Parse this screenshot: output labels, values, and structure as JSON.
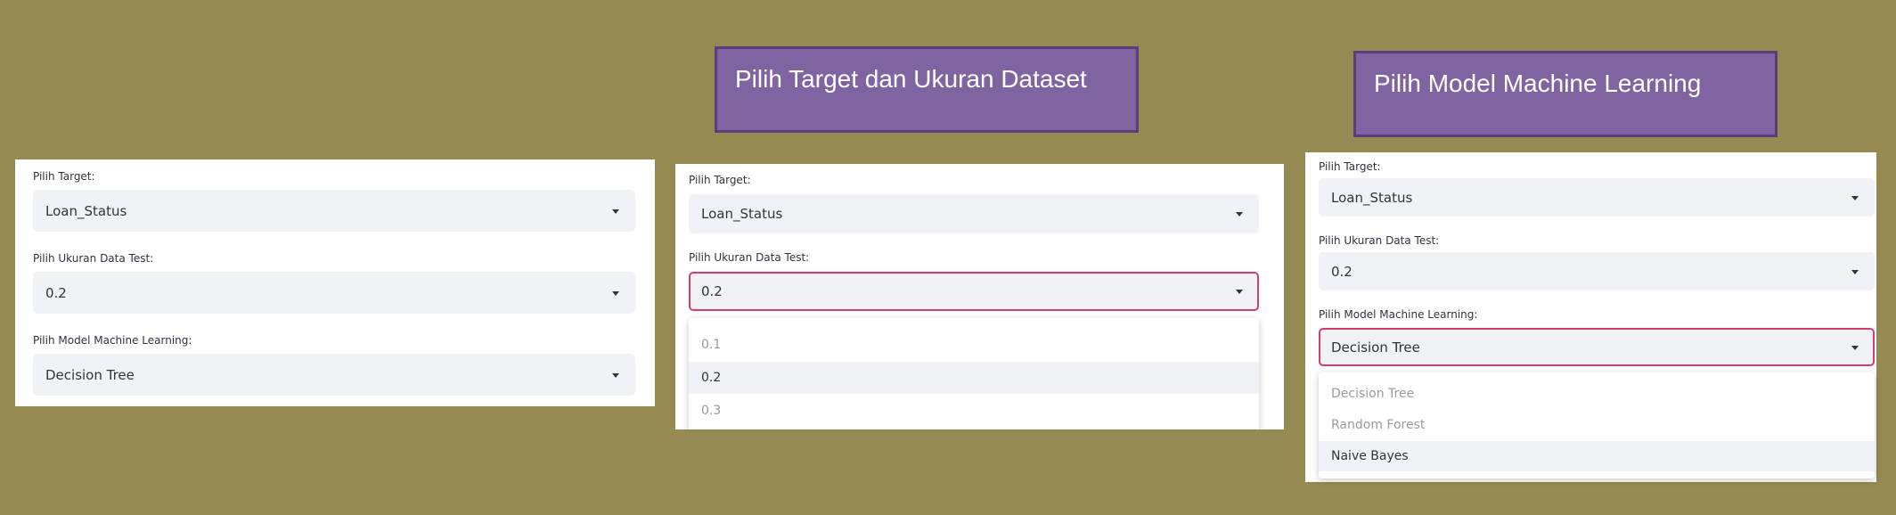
{
  "banners": {
    "target_dataset": "Pilih Target dan Ukuran Dataset",
    "model_ml": "Pilih Model Machine Learning"
  },
  "panel1": {
    "target_label": "Pilih Target:",
    "target_value": "Loan_Status",
    "test_size_label": "Pilih Ukuran Data Test:",
    "test_size_value": "0.2",
    "model_label": "Pilih Model Machine Learning:",
    "model_value": "Decision Tree"
  },
  "panel2": {
    "target_label": "Pilih Target:",
    "target_value": "Loan_Status",
    "test_size_label": "Pilih Ukuran Data Test:",
    "test_size_value": "0.2",
    "test_size_options": [
      "0.1",
      "0.2",
      "0.3"
    ],
    "highlighted_option": "0.2"
  },
  "panel3": {
    "target_label": "Pilih Target:",
    "target_value": "Loan_Status",
    "test_size_label": "Pilih Ukuran Data Test:",
    "test_size_value": "0.2",
    "model_label": "Pilih Model Machine Learning:",
    "model_value": "Decision Tree",
    "model_options": [
      "Decision Tree",
      "Random Forest",
      "Naive Bayes"
    ],
    "highlighted_option": "Naive Bayes"
  },
  "colors": {
    "background": "#958a52",
    "banner_fill": "#8064a2",
    "banner_border": "#5a3d7a",
    "select_bg": "#f0f2f6",
    "focus_border": "#d33f6a"
  },
  "icons": {
    "select_caret": "caret-down-icon"
  }
}
